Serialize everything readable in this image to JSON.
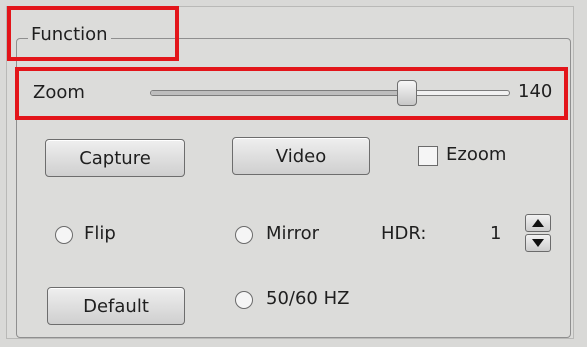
{
  "group": {
    "title": "Function"
  },
  "zoom": {
    "label": "Zoom",
    "value_text": "140",
    "level_fraction": 0.715
  },
  "buttons": {
    "capture": "Capture",
    "video": "Video",
    "default": "Default"
  },
  "ezoom": {
    "label": "Ezoom",
    "checked": false
  },
  "options": {
    "flip": "Flip",
    "mirror": "Mirror",
    "hz": "50/60 HZ"
  },
  "hdr": {
    "label": "HDR:",
    "value": "1"
  },
  "colors": {
    "highlight": "#e3151a",
    "panel": "#dcdcda"
  }
}
